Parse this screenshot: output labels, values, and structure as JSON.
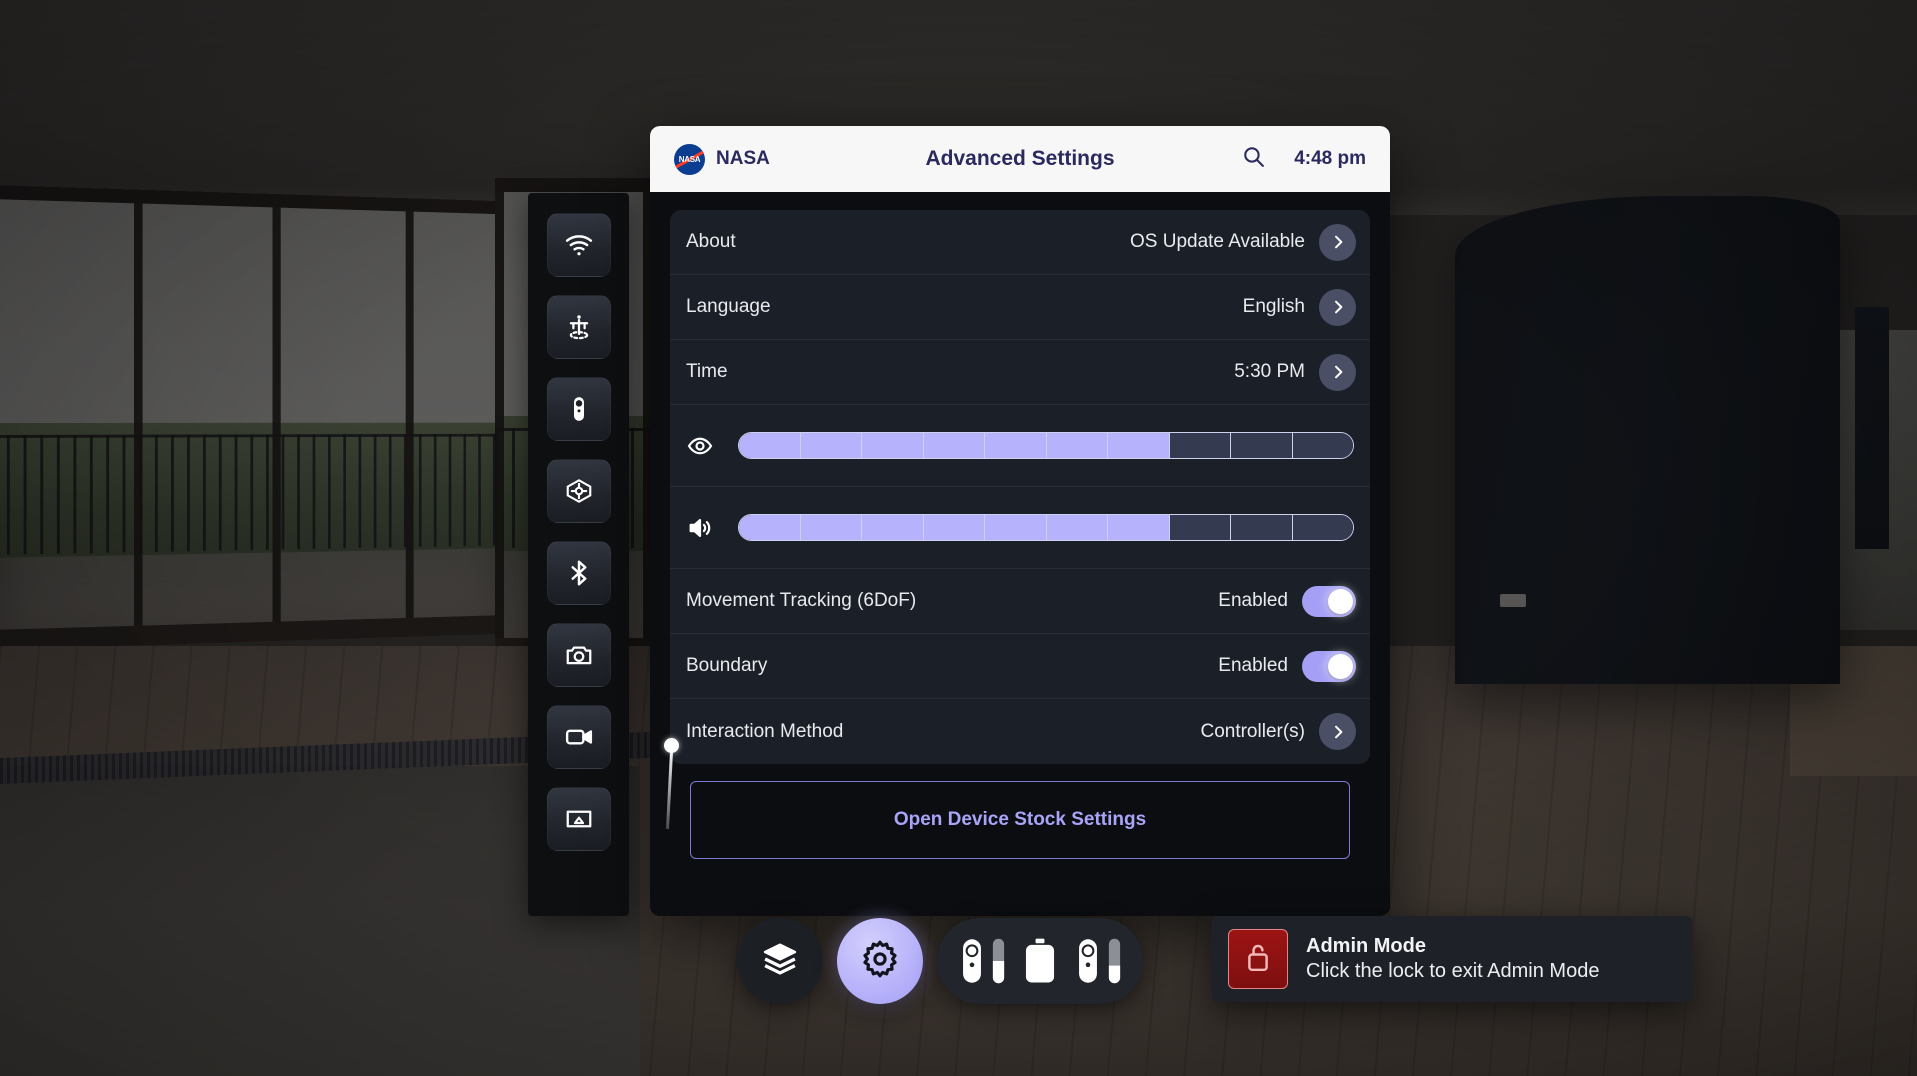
{
  "scene": {
    "environment_name": "apartment-interior-360",
    "background_colors": {
      "ceiling": "#4b4742",
      "floor": "#6b5c50",
      "pillar": "#14181e",
      "sky": "#9b9a96"
    }
  },
  "left_toolbar": {
    "items": [
      {
        "name": "wifi-icon",
        "label": "Wi-Fi"
      },
      {
        "name": "height-calibration-icon",
        "label": "Height Calibration"
      },
      {
        "name": "controller-icon",
        "label": "Controller"
      },
      {
        "name": "recenter-icon",
        "label": "Recenter View"
      },
      {
        "name": "bluetooth-icon",
        "label": "Bluetooth"
      },
      {
        "name": "camera-icon",
        "label": "Screenshot"
      },
      {
        "name": "video-camera-icon",
        "label": "Record Video"
      },
      {
        "name": "cast-icon",
        "label": "Cast Screen"
      }
    ]
  },
  "panel": {
    "brand": "NASA",
    "title": "Advanced Settings",
    "clock": "4:48 pm",
    "search_icon": "search-icon",
    "rows": [
      {
        "type": "nav",
        "label": "About",
        "value": "OS Update Available"
      },
      {
        "type": "nav",
        "label": "Language",
        "value": "English"
      },
      {
        "type": "nav",
        "label": "Time",
        "value": "5:30 PM"
      },
      {
        "type": "slider",
        "icon": "brightness-eye-icon",
        "segments": 10,
        "filled": 7
      },
      {
        "type": "slider",
        "icon": "volume-icon",
        "segments": 10,
        "filled": 7
      },
      {
        "type": "toggle",
        "label": "Movement Tracking (6DoF)",
        "value": "Enabled",
        "on": true
      },
      {
        "type": "toggle",
        "label": "Boundary",
        "value": "Enabled",
        "on": true
      },
      {
        "type": "nav",
        "label": "Interaction Method",
        "value": "Controller(s)"
      }
    ],
    "stock_settings_button": "Open Device Stock Settings",
    "colors": {
      "header_bg": "#f7f7f8",
      "header_text": "#2b2a5e",
      "card_bg": "#1b2028",
      "panel_bg": "#0b0d10",
      "accent": "#a5a0f5",
      "chevron_bg": "#4a4f66",
      "slider_fill": "#b6b2fb",
      "slider_empty": "#343a4f"
    }
  },
  "dock": {
    "items": [
      {
        "name": "layers-icon",
        "label": "Layers",
        "active": false
      },
      {
        "name": "gear-icon",
        "label": "Settings",
        "active": true
      }
    ],
    "battery": {
      "left_controller_percent": 50,
      "headset_percent": 100,
      "right_controller_percent": 40
    }
  },
  "admin_toast": {
    "icon": "unlocked-padlock-icon",
    "title": "Admin Mode",
    "subtitle": "Click the lock to exit Admin Mode",
    "accent": "#9c1414"
  }
}
